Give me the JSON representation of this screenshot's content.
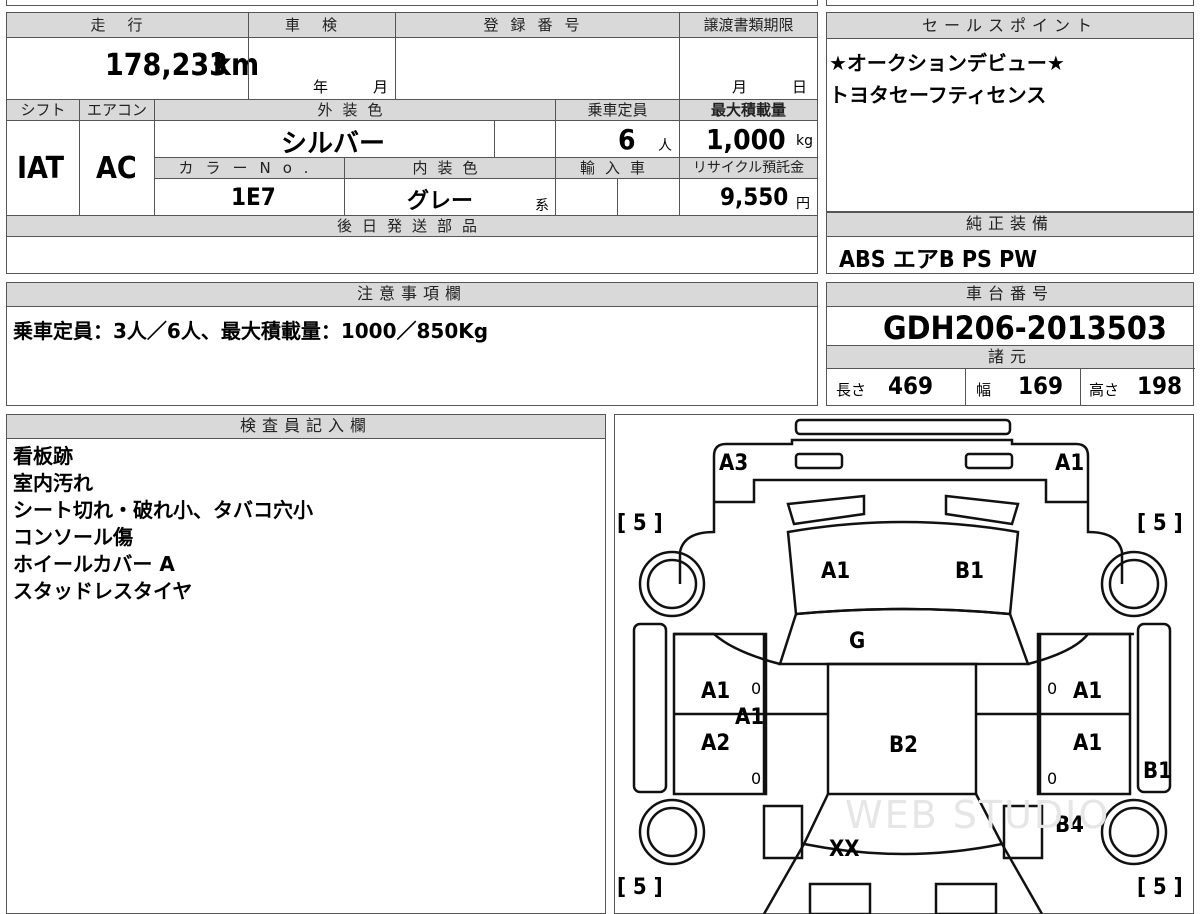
{
  "top": {
    "mileage_header": "走行",
    "shaken_header": "車検",
    "reg_header": "登録番号",
    "transfer_header": "譲渡書類期限",
    "mileage_value": "178,233",
    "mileage_unit": "km",
    "shaken_year": "年",
    "shaken_month": "月",
    "transfer_month": "月",
    "transfer_day": "日",
    "shift_header": "シフト",
    "ac_header": "エアコン",
    "ext_color_header": "外装色",
    "capacity_header": "乗車定員",
    "max_load_header": "最大積載量",
    "shift_value": "IAT",
    "ac_value": "AC",
    "ext_color_value": "シルバー",
    "capacity_value": "6",
    "capacity_unit": "人",
    "max_load_value": "1,000",
    "max_load_unit": "kg",
    "color_no_header": "カラーNo.",
    "int_color_header": "内装色",
    "import_header": "輸入車",
    "recycle_header": "リサイクル預託金",
    "color_no_value": "1E7",
    "int_color_value": "グレー",
    "int_color_suffix": "系",
    "recycle_value": "9,550",
    "recycle_unit": "円",
    "later_parts_header": "後日発送部品"
  },
  "sales": {
    "header": "セールスポイント",
    "lines": [
      "★オークションデビュー★",
      "トヨタセーフティセンス"
    ]
  },
  "equipment": {
    "header": "純正装備",
    "value": "ABS エアB PS PW"
  },
  "caution": {
    "header": "注意事項欄",
    "text": "乗車定員：3人／6人、最大積載量：1000／850Kg"
  },
  "chassis": {
    "header": "車台番号",
    "value": "GDH206-2013503",
    "specs_header": "諸元",
    "length_label": "長さ",
    "length_value": "469",
    "width_label": "幅",
    "width_value": "169",
    "height_label": "高さ",
    "height_value": "198"
  },
  "inspector": {
    "header": "検査員記入欄",
    "notes": [
      "看板跡",
      "室内汚れ",
      "シート切れ・破れ小、タバコ穴小",
      "コンソール傷",
      "ホイールカバー A",
      "スタッドレスタイヤ"
    ]
  },
  "diagram": {
    "tire_tl": "[ 5 ]",
    "tire_tr": "[ 5 ]",
    "tire_bl": "[ 5 ]",
    "tire_br": "[ 5 ]",
    "rear_left": "A3",
    "rear_right": "A1",
    "roof_left": "A1",
    "roof_right": "B1",
    "center": "G",
    "left_upper": "A1",
    "left_mid": "A1",
    "left_lower": "A2",
    "floor": "B2",
    "right_upper": "A1",
    "right_lower": "A1",
    "right_side": "B1",
    "right_rear": "B4",
    "hood": "XX",
    "zero_a": "0",
    "zero_b": "0",
    "zero_c": "0",
    "zero_d": "0",
    "watermark": "WEB STUDIO"
  }
}
